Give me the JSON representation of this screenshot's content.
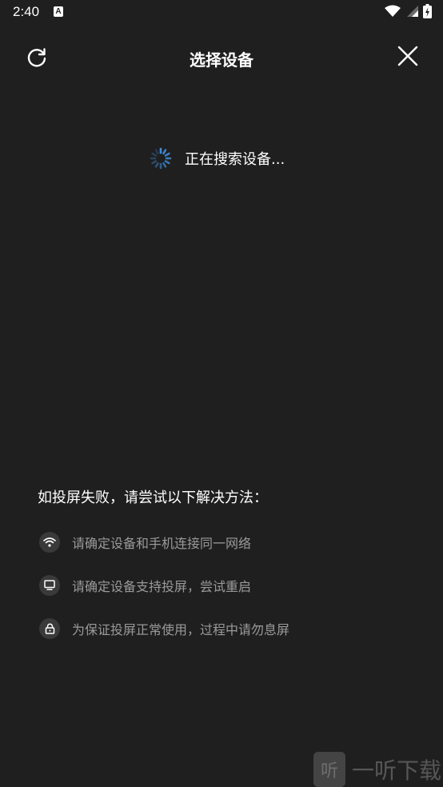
{
  "status": {
    "time": "2:40",
    "app_indicator": "A",
    "icons": [
      "wifi-icon",
      "signal-icon",
      "battery-icon"
    ]
  },
  "header": {
    "title": "选择设备",
    "refresh_icon": "refresh-icon",
    "close_icon": "close-icon"
  },
  "search": {
    "status_text": "正在搜索设备..."
  },
  "tips": {
    "title": "如投屏失败，请尝试以下解决方法：",
    "items": [
      {
        "icon": "wifi-icon",
        "text": "请确定设备和手机连接同一网络"
      },
      {
        "icon": "tv-icon",
        "text": "请确定设备支持投屏，尝试重启"
      },
      {
        "icon": "lock-icon",
        "text": "为保证投屏正常使用，过程中请勿息屏"
      }
    ]
  },
  "watermark": {
    "logo_char": "听",
    "text": "一听下载"
  },
  "colors": {
    "background": "#1f1f1f",
    "spinner": "#3d8bd9",
    "tip_text": "#9a9a9a",
    "icon_bg": "#3a3a3a"
  }
}
